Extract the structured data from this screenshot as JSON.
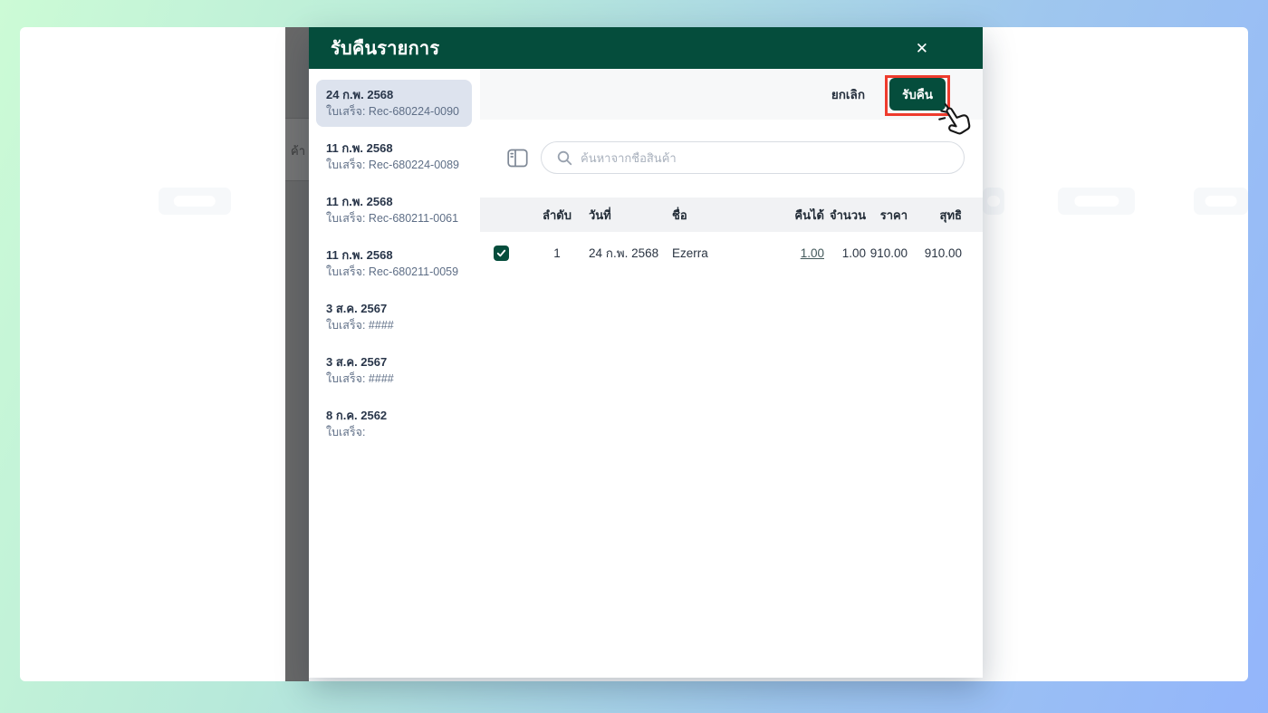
{
  "colors": {
    "brand_green": "#054d3c",
    "annotation_red": "#ee3b2d",
    "selected_item_bg": "#dde3ee",
    "gradient_start": "#ccfbd6",
    "gradient_end": "#93b5fb"
  },
  "page": {
    "dimmed_fragment_text": "ค้า"
  },
  "modal": {
    "title": "รับคืนรายการ",
    "close_icon": "✕",
    "toolbar": {
      "cancel_label": "ยกเลิก",
      "submit_label": "รับคืน"
    },
    "sidebar": {
      "items": [
        {
          "date": "24 ก.พ. 2568",
          "receipt": "ใบเสร็จ: Rec-680224-0090",
          "selected": true
        },
        {
          "date": "11 ก.พ. 2568",
          "receipt": "ใบเสร็จ: Rec-680224-0089",
          "selected": false
        },
        {
          "date": "11 ก.พ. 2568",
          "receipt": "ใบเสร็จ: Rec-680211-0061",
          "selected": false
        },
        {
          "date": "11 ก.พ. 2568",
          "receipt": "ใบเสร็จ: Rec-680211-0059",
          "selected": false
        },
        {
          "date": "3 ส.ค. 2567",
          "receipt": "ใบเสร็จ: ####",
          "selected": false
        },
        {
          "date": "3 ส.ค. 2567",
          "receipt": "ใบเสร็จ: ####",
          "selected": false
        },
        {
          "date": "8 ก.ค. 2562",
          "receipt": "ใบเสร็จ:",
          "selected": false
        }
      ]
    },
    "search": {
      "placeholder": "ค้นหาจากชื่อสินค้า",
      "icon": "magnifier-icon"
    },
    "panel_toggle_icon": "sidebar-layout-icon",
    "table": {
      "columns": [
        "ลำดับ",
        "วันที่",
        "ชื่อ",
        "คืนได้",
        "จำนวน",
        "ราคา",
        "สุทธิ"
      ],
      "rows": [
        {
          "checked": true,
          "order": "1",
          "date": "24 ก.พ. 2568",
          "name": "Ezerra",
          "returnable": "1.00",
          "quantity": "1.00",
          "price": "910.00",
          "net": "910.00"
        }
      ]
    }
  },
  "cursor": {
    "type": "hand-pointer-click"
  }
}
